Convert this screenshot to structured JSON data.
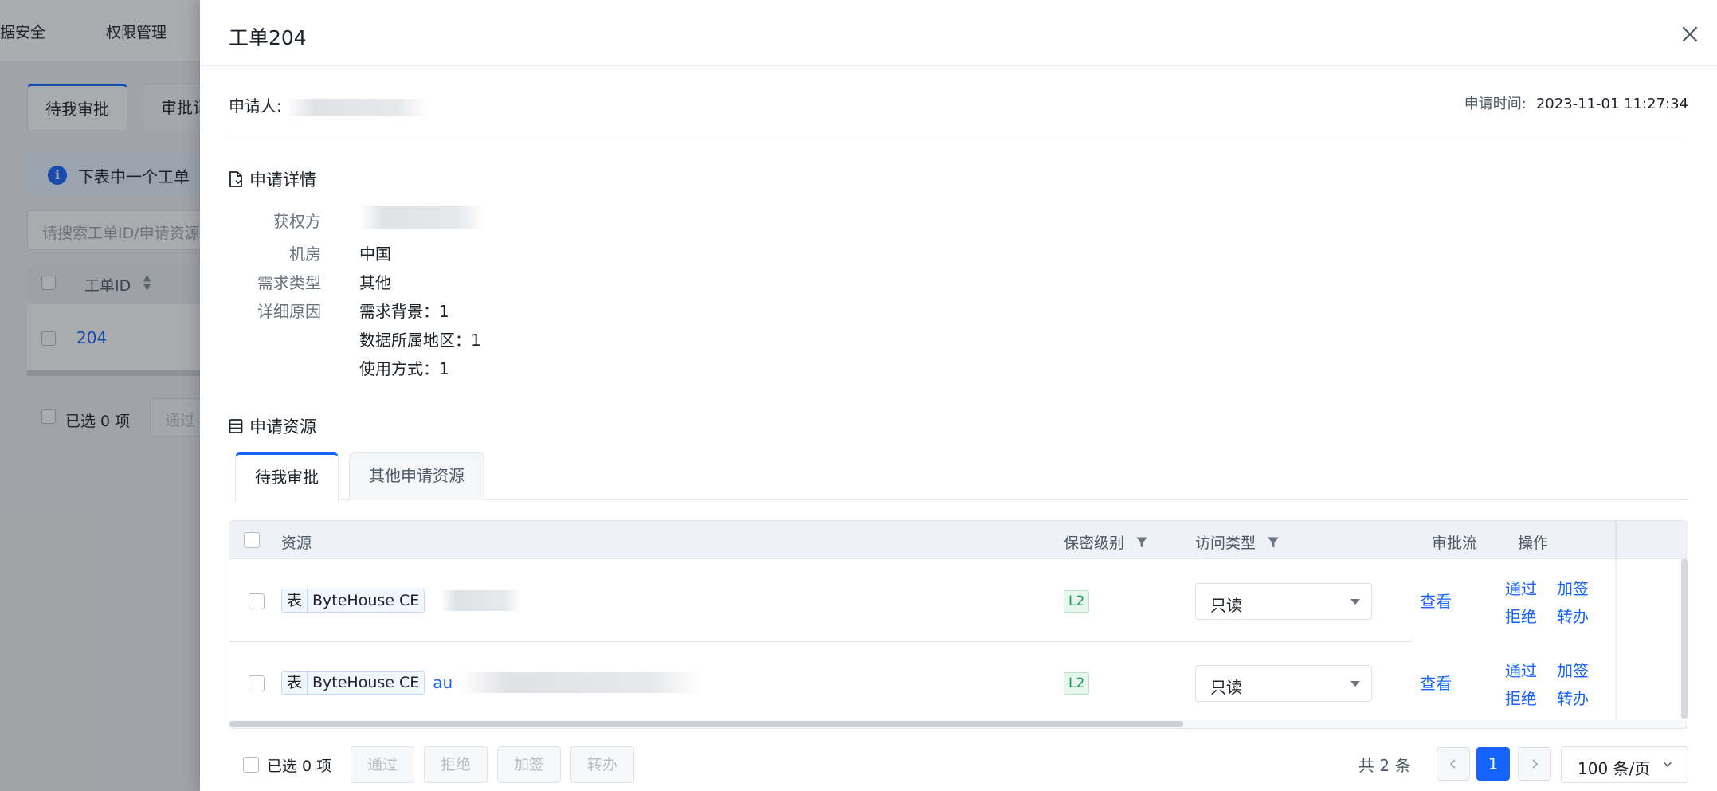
{
  "background": {
    "nav_items": [
      "据安全",
      "权限管理"
    ],
    "tabs": [
      "待我审批",
      "审批记"
    ],
    "alert_text": "下表中一个工单",
    "search_placeholder": "请搜索工单ID/申请资源",
    "col_id": "工单ID",
    "row_id": "204",
    "selected": "已选 0 项",
    "footer_btn": "通过"
  },
  "drawer": {
    "title": "工单204",
    "applicant_label": "申请人:",
    "apply_time_label": "申请时间:",
    "apply_time_value": "2023-11-01 11:27:34",
    "details_title": "申请详情",
    "details": {
      "grantee_label": "获权方",
      "room_label": "机房",
      "room_value": "中国",
      "type_label": "需求类型",
      "type_value": "其他",
      "reason_label": "详细原因",
      "reason_lines": [
        "需求背景：1",
        "数据所属地区：1",
        "使用方式：1"
      ]
    },
    "resources_title": "申请资源",
    "tabs": [
      {
        "label": "待我审批",
        "active": true
      },
      {
        "label": "其他申请资源",
        "active": false
      }
    ],
    "table": {
      "headers": {
        "resource": "资源",
        "level": "保密级别",
        "access": "访问类型",
        "flow": "审批流",
        "ops": "操作"
      },
      "rows": [
        {
          "type_tag": "表",
          "source_tag": "ByteHouse CE",
          "name": "",
          "level": "L2",
          "access": "只读",
          "view": "查看",
          "approve": "通过",
          "countersign": "加签",
          "reject": "拒绝",
          "transfer": "转办"
        },
        {
          "type_tag": "表",
          "source_tag": "ByteHouse CE",
          "name": "au",
          "level": "L2",
          "access": "只读",
          "view": "查看",
          "approve": "通过",
          "countersign": "加签",
          "reject": "拒绝",
          "transfer": "转办"
        }
      ]
    },
    "footer": {
      "selected": "已选 0 项",
      "buttons": [
        "通过",
        "拒绝",
        "加签",
        "转办"
      ],
      "total": "共 2 条",
      "current_page": "1",
      "page_size": "100 条/页"
    }
  },
  "colors": {
    "primary": "#1664ff",
    "level_tag": "#0f9d58"
  }
}
